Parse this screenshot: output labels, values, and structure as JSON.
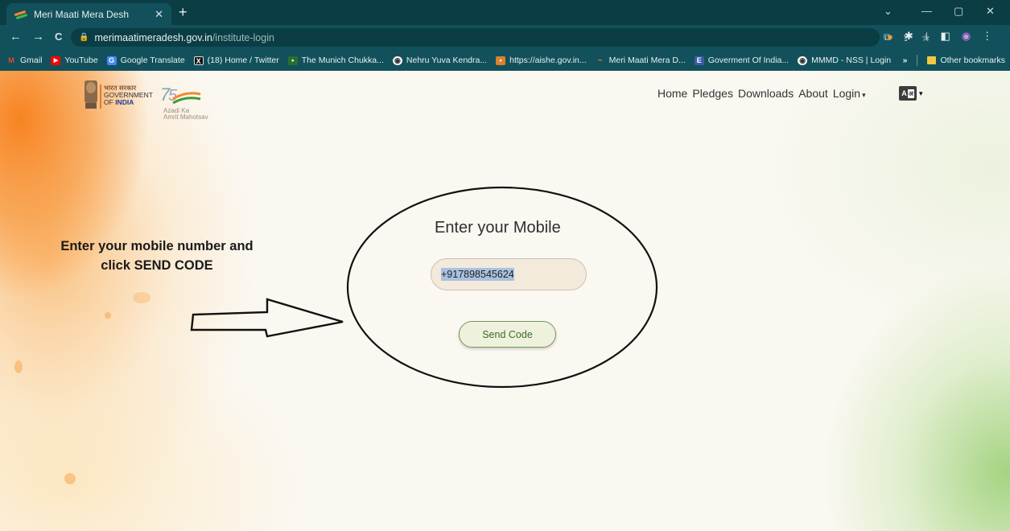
{
  "browser": {
    "tab_title": "Meri Maati Mera Desh",
    "tab_close": "✕",
    "new_tab": "+",
    "window_controls": [
      "⌄",
      "—",
      "▢",
      "✕"
    ],
    "nav_buttons": [
      "←",
      "→",
      "C"
    ],
    "url_host": "merimaatimeradesh.gov.in",
    "url_path": "/institute-login",
    "bookmarks": [
      {
        "label": "Gmail",
        "icon": "gmail-icon",
        "color": "#ea4335",
        "glyph": "M"
      },
      {
        "label": "YouTube",
        "icon": "youtube-icon",
        "color": "#ff0000",
        "glyph": "▶"
      },
      {
        "label": "Google Translate",
        "icon": "translate-icon",
        "color": "#4285f4",
        "glyph": "G"
      },
      {
        "label": "(18) Home / Twitter",
        "icon": "x-icon",
        "color": "#111111",
        "glyph": "X"
      },
      {
        "label": "The Munich Chukka...",
        "icon": "munich-icon",
        "color": "#2b6e2b",
        "glyph": "•"
      },
      {
        "label": "Nehru Yuva Kendra...",
        "icon": "globe-icon",
        "color": "#2a2a2a",
        "glyph": "◉"
      },
      {
        "label": "https://aishe.gov.in...",
        "icon": "aishe-icon",
        "color": "#d9822b",
        "glyph": "▪"
      },
      {
        "label": "Meri Maati Mera D...",
        "icon": "mmmd-icon",
        "color": "#4bb34b",
        "glyph": "~"
      },
      {
        "label": "Goverment Of India...",
        "icon": "gov-icon",
        "color": "#3b5ba9",
        "glyph": "E"
      },
      {
        "label": "MMMD - NSS | Login",
        "icon": "globe-icon",
        "color": "#2a2a2a",
        "glyph": "◉"
      }
    ],
    "overflow": "»",
    "other_bookmarks": "Other bookmarks"
  },
  "header": {
    "gov_hindi": "भारत सरकार",
    "gov_line1": "GOVERNMENT",
    "gov_of": "OF",
    "gov_india": "INDIA",
    "azadi_line1": "Azadi Ka",
    "azadi_line2": "Amrit Mahotsav",
    "nav": [
      {
        "label": "Home"
      },
      {
        "label": "Pledges"
      },
      {
        "label": "Downloads"
      },
      {
        "label": "About"
      },
      {
        "label": "Login"
      }
    ],
    "caret": "▾",
    "lang_a": "A",
    "lang_b": "अ"
  },
  "instruction": {
    "line1": "Enter your mobile number and",
    "line2": "click SEND CODE"
  },
  "form": {
    "title": "Enter your Mobile",
    "mobile_value": "+917898545624",
    "send_label": "Send Code"
  }
}
